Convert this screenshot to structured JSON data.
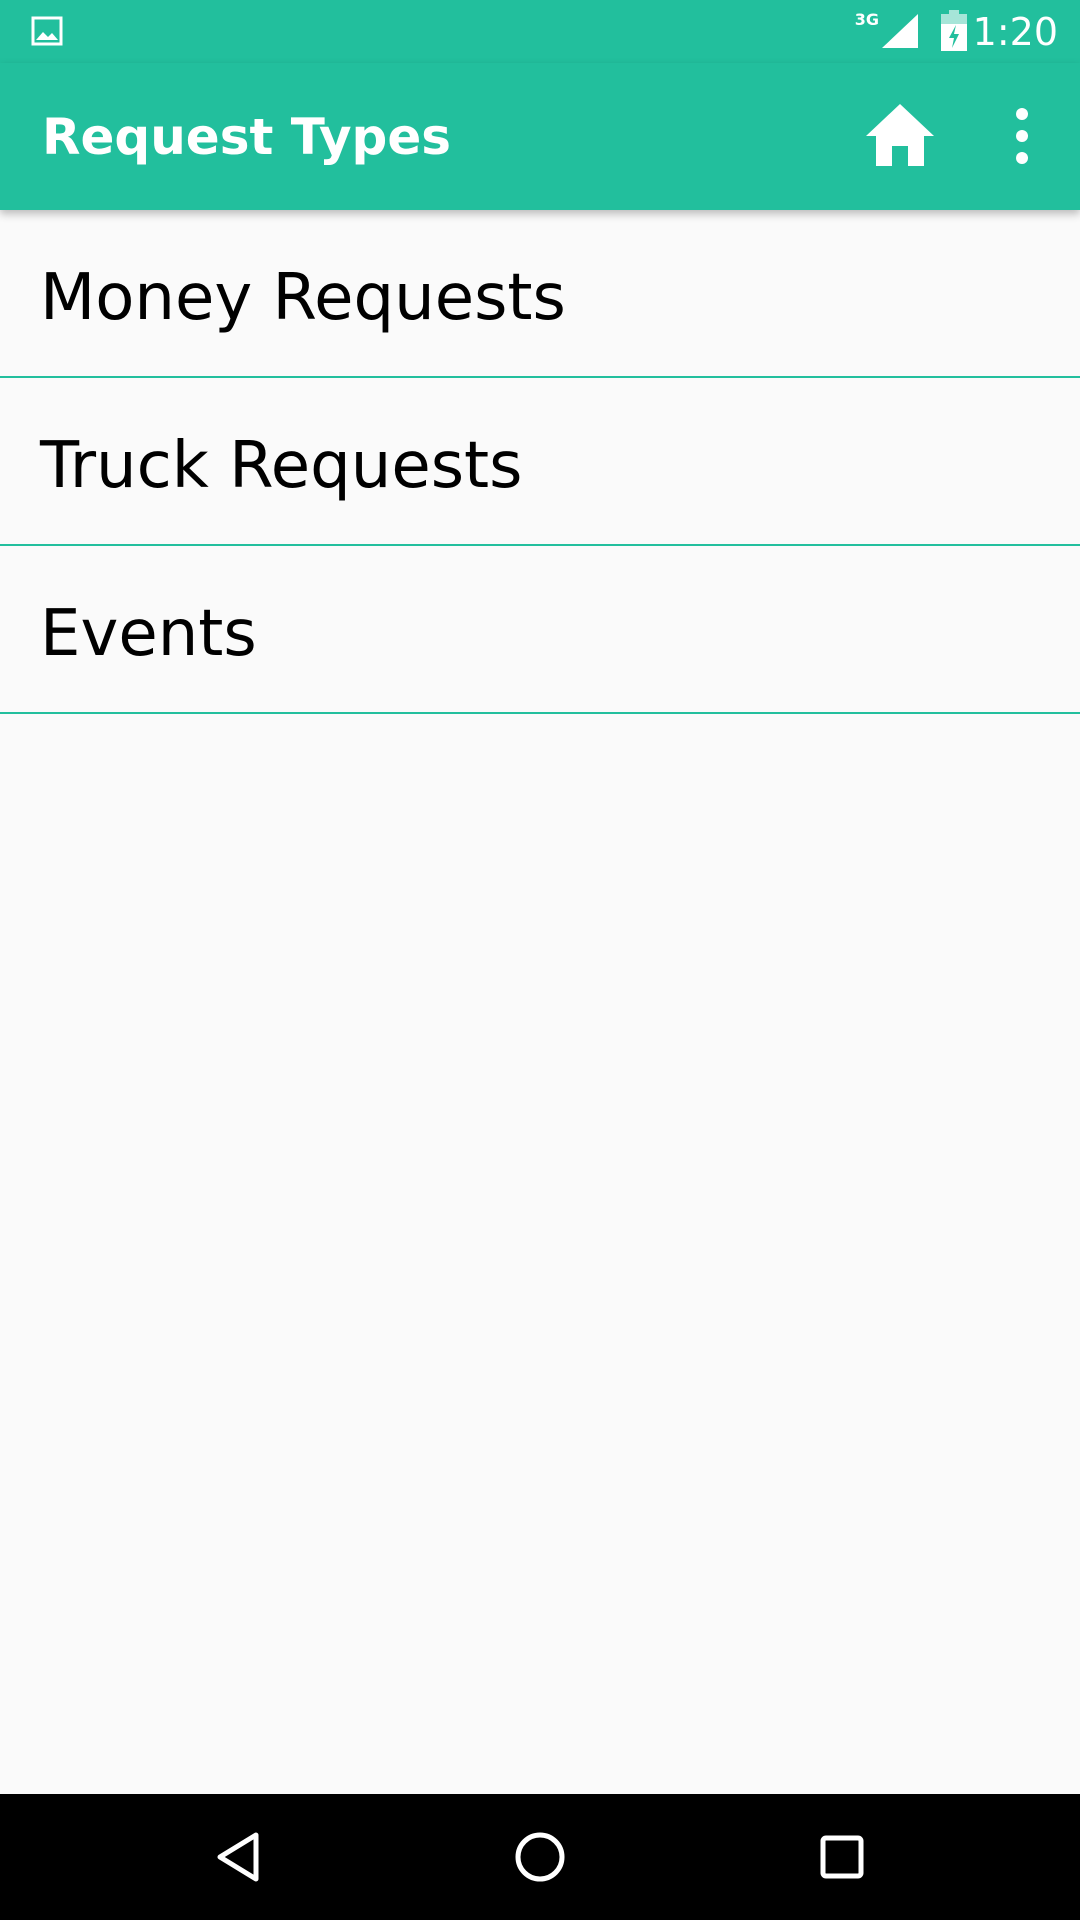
{
  "status_bar": {
    "network_type": "3G",
    "time": "1:20",
    "icons": [
      "image-notification-icon",
      "signal-icon",
      "battery-charging-icon"
    ]
  },
  "app_bar": {
    "title": "Request Types",
    "actions": [
      "home-icon",
      "more-vert-icon"
    ]
  },
  "list": {
    "items": [
      {
        "label": "Money Requests"
      },
      {
        "label": "Truck Requests"
      },
      {
        "label": "Events"
      }
    ]
  },
  "nav_bar": {
    "icons": [
      "back-icon",
      "home-circle-icon",
      "recents-icon"
    ]
  },
  "colors": {
    "primary": "#22bf9d",
    "background": "#fafafa",
    "divider": "#22bf9d",
    "nav_bar": "#000000",
    "text": "#000000"
  }
}
